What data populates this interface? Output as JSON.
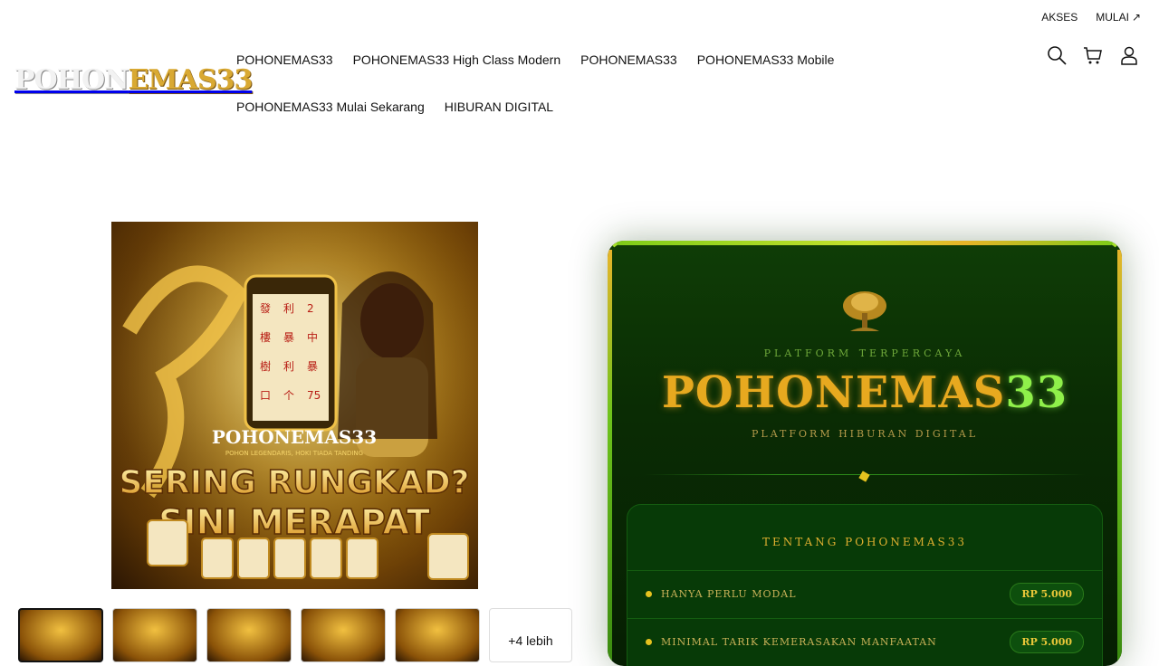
{
  "topbar": {
    "akses": "AKSES",
    "mulai": "MULAI",
    "mulai_icon": "arrow-up-right-icon"
  },
  "logo": {
    "text_white": "POHON",
    "text_gold": "EMAS33"
  },
  "nav": [
    "POHONEMAS33",
    "POHONEMAS33 High Class Modern",
    "POHONEMAS33",
    "POHONEMAS33 Mobile",
    "POHONEMAS33 Mulai Sekarang",
    "HIBURAN DIGITAL"
  ],
  "header_icons": [
    "search-icon",
    "cart-icon",
    "account-icon"
  ],
  "banner": {
    "brand": "POHONEMAS33",
    "tagline": "POHON LEGENDARIS, HOKI TIADA TANDING",
    "headline1": "SERING RUNGKAD?",
    "headline2": "SINI MERAPAT"
  },
  "gallery": {
    "more_label": "+4 lebih"
  },
  "panel": {
    "subtitle_top": "PLATFORM TERPERCAYA",
    "title_main": "POHONEMAS",
    "title_num": "33",
    "subtitle_bottom": "PLATFORM HIBURAN DIGITAL",
    "box_title": "TENTANG POHONEMAS33",
    "rows": [
      {
        "label": "HANYA PERLU MODAL",
        "value": "RP 5.000"
      },
      {
        "label": "MINIMAL TARIK KEMERASAKAN MANFAATAN",
        "value": "RP 5.000"
      }
    ]
  },
  "colors": {
    "gold": "#e7a91f",
    "green": "#8ff04a",
    "panel_bg": "#0a2c04"
  }
}
